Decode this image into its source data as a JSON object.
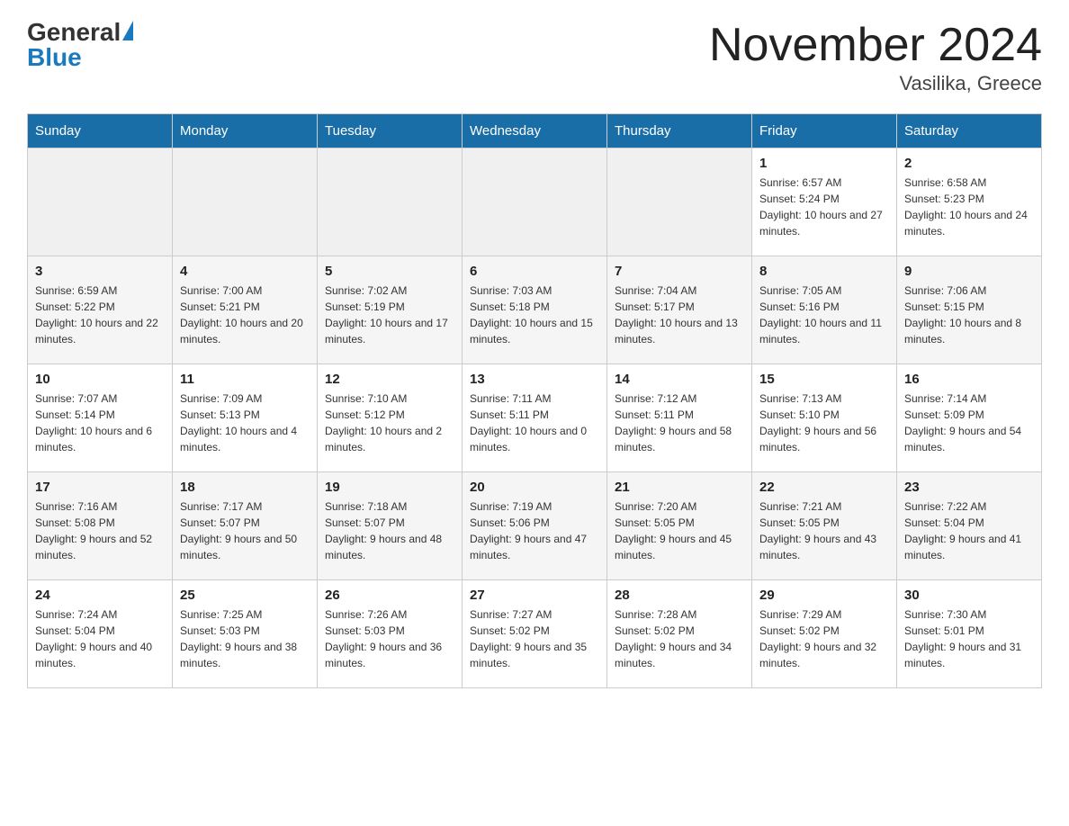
{
  "header": {
    "logo_general": "General",
    "logo_blue": "Blue",
    "month_title": "November 2024",
    "location": "Vasilika, Greece"
  },
  "weekdays": [
    "Sunday",
    "Monday",
    "Tuesday",
    "Wednesday",
    "Thursday",
    "Friday",
    "Saturday"
  ],
  "weeks": [
    {
      "days": [
        {
          "number": "",
          "sunrise": "",
          "sunset": "",
          "daylight": ""
        },
        {
          "number": "",
          "sunrise": "",
          "sunset": "",
          "daylight": ""
        },
        {
          "number": "",
          "sunrise": "",
          "sunset": "",
          "daylight": ""
        },
        {
          "number": "",
          "sunrise": "",
          "sunset": "",
          "daylight": ""
        },
        {
          "number": "",
          "sunrise": "",
          "sunset": "",
          "daylight": ""
        },
        {
          "number": "1",
          "sunrise": "Sunrise: 6:57 AM",
          "sunset": "Sunset: 5:24 PM",
          "daylight": "Daylight: 10 hours and 27 minutes."
        },
        {
          "number": "2",
          "sunrise": "Sunrise: 6:58 AM",
          "sunset": "Sunset: 5:23 PM",
          "daylight": "Daylight: 10 hours and 24 minutes."
        }
      ]
    },
    {
      "days": [
        {
          "number": "3",
          "sunrise": "Sunrise: 6:59 AM",
          "sunset": "Sunset: 5:22 PM",
          "daylight": "Daylight: 10 hours and 22 minutes."
        },
        {
          "number": "4",
          "sunrise": "Sunrise: 7:00 AM",
          "sunset": "Sunset: 5:21 PM",
          "daylight": "Daylight: 10 hours and 20 minutes."
        },
        {
          "number": "5",
          "sunrise": "Sunrise: 7:02 AM",
          "sunset": "Sunset: 5:19 PM",
          "daylight": "Daylight: 10 hours and 17 minutes."
        },
        {
          "number": "6",
          "sunrise": "Sunrise: 7:03 AM",
          "sunset": "Sunset: 5:18 PM",
          "daylight": "Daylight: 10 hours and 15 minutes."
        },
        {
          "number": "7",
          "sunrise": "Sunrise: 7:04 AM",
          "sunset": "Sunset: 5:17 PM",
          "daylight": "Daylight: 10 hours and 13 minutes."
        },
        {
          "number": "8",
          "sunrise": "Sunrise: 7:05 AM",
          "sunset": "Sunset: 5:16 PM",
          "daylight": "Daylight: 10 hours and 11 minutes."
        },
        {
          "number": "9",
          "sunrise": "Sunrise: 7:06 AM",
          "sunset": "Sunset: 5:15 PM",
          "daylight": "Daylight: 10 hours and 8 minutes."
        }
      ]
    },
    {
      "days": [
        {
          "number": "10",
          "sunrise": "Sunrise: 7:07 AM",
          "sunset": "Sunset: 5:14 PM",
          "daylight": "Daylight: 10 hours and 6 minutes."
        },
        {
          "number": "11",
          "sunrise": "Sunrise: 7:09 AM",
          "sunset": "Sunset: 5:13 PM",
          "daylight": "Daylight: 10 hours and 4 minutes."
        },
        {
          "number": "12",
          "sunrise": "Sunrise: 7:10 AM",
          "sunset": "Sunset: 5:12 PM",
          "daylight": "Daylight: 10 hours and 2 minutes."
        },
        {
          "number": "13",
          "sunrise": "Sunrise: 7:11 AM",
          "sunset": "Sunset: 5:11 PM",
          "daylight": "Daylight: 10 hours and 0 minutes."
        },
        {
          "number": "14",
          "sunrise": "Sunrise: 7:12 AM",
          "sunset": "Sunset: 5:11 PM",
          "daylight": "Daylight: 9 hours and 58 minutes."
        },
        {
          "number": "15",
          "sunrise": "Sunrise: 7:13 AM",
          "sunset": "Sunset: 5:10 PM",
          "daylight": "Daylight: 9 hours and 56 minutes."
        },
        {
          "number": "16",
          "sunrise": "Sunrise: 7:14 AM",
          "sunset": "Sunset: 5:09 PM",
          "daylight": "Daylight: 9 hours and 54 minutes."
        }
      ]
    },
    {
      "days": [
        {
          "number": "17",
          "sunrise": "Sunrise: 7:16 AM",
          "sunset": "Sunset: 5:08 PM",
          "daylight": "Daylight: 9 hours and 52 minutes."
        },
        {
          "number": "18",
          "sunrise": "Sunrise: 7:17 AM",
          "sunset": "Sunset: 5:07 PM",
          "daylight": "Daylight: 9 hours and 50 minutes."
        },
        {
          "number": "19",
          "sunrise": "Sunrise: 7:18 AM",
          "sunset": "Sunset: 5:07 PM",
          "daylight": "Daylight: 9 hours and 48 minutes."
        },
        {
          "number": "20",
          "sunrise": "Sunrise: 7:19 AM",
          "sunset": "Sunset: 5:06 PM",
          "daylight": "Daylight: 9 hours and 47 minutes."
        },
        {
          "number": "21",
          "sunrise": "Sunrise: 7:20 AM",
          "sunset": "Sunset: 5:05 PM",
          "daylight": "Daylight: 9 hours and 45 minutes."
        },
        {
          "number": "22",
          "sunrise": "Sunrise: 7:21 AM",
          "sunset": "Sunset: 5:05 PM",
          "daylight": "Daylight: 9 hours and 43 minutes."
        },
        {
          "number": "23",
          "sunrise": "Sunrise: 7:22 AM",
          "sunset": "Sunset: 5:04 PM",
          "daylight": "Daylight: 9 hours and 41 minutes."
        }
      ]
    },
    {
      "days": [
        {
          "number": "24",
          "sunrise": "Sunrise: 7:24 AM",
          "sunset": "Sunset: 5:04 PM",
          "daylight": "Daylight: 9 hours and 40 minutes."
        },
        {
          "number": "25",
          "sunrise": "Sunrise: 7:25 AM",
          "sunset": "Sunset: 5:03 PM",
          "daylight": "Daylight: 9 hours and 38 minutes."
        },
        {
          "number": "26",
          "sunrise": "Sunrise: 7:26 AM",
          "sunset": "Sunset: 5:03 PM",
          "daylight": "Daylight: 9 hours and 36 minutes."
        },
        {
          "number": "27",
          "sunrise": "Sunrise: 7:27 AM",
          "sunset": "Sunset: 5:02 PM",
          "daylight": "Daylight: 9 hours and 35 minutes."
        },
        {
          "number": "28",
          "sunrise": "Sunrise: 7:28 AM",
          "sunset": "Sunset: 5:02 PM",
          "daylight": "Daylight: 9 hours and 34 minutes."
        },
        {
          "number": "29",
          "sunrise": "Sunrise: 7:29 AM",
          "sunset": "Sunset: 5:02 PM",
          "daylight": "Daylight: 9 hours and 32 minutes."
        },
        {
          "number": "30",
          "sunrise": "Sunrise: 7:30 AM",
          "sunset": "Sunset: 5:01 PM",
          "daylight": "Daylight: 9 hours and 31 minutes."
        }
      ]
    }
  ]
}
